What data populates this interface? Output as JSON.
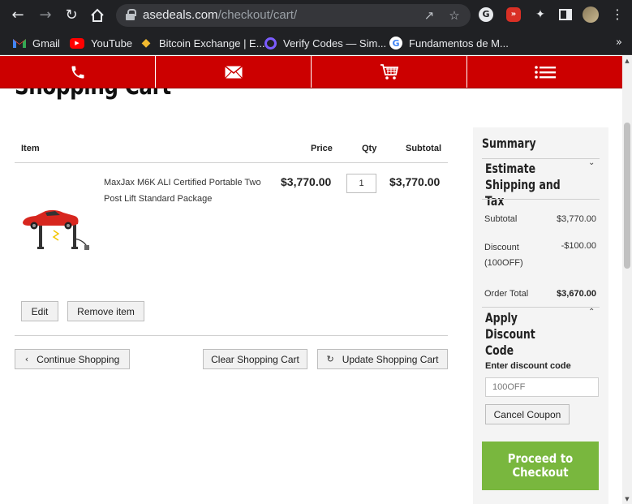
{
  "browser": {
    "url_host": "asedeals.com",
    "url_path": "/checkout/cart/",
    "bookmarks": [
      {
        "label": "Gmail",
        "icon": "gmail-icon"
      },
      {
        "label": "YouTube",
        "icon": "youtube-icon"
      },
      {
        "label": "Bitcoin Exchange | E...",
        "icon": "binance-icon"
      },
      {
        "label": "Verify Codes — Sim...",
        "icon": "verify-codes-icon"
      },
      {
        "label": "Fundamentos de M...",
        "icon": "google-icon"
      }
    ]
  },
  "topbar": {
    "background": "#cc0000",
    "items": [
      "phone-icon",
      "mail-icon",
      "cart-icon",
      "menu-icon"
    ]
  },
  "page": {
    "title": "Shopping Cart"
  },
  "cart": {
    "headers": {
      "item": "Item",
      "price": "Price",
      "qty": "Qty",
      "subtotal": "Subtotal"
    },
    "items": [
      {
        "name": "MaxJax M6K ALI Certified Portable Two Post Lift Standard Package",
        "price": "$3,770.00",
        "qty": "1",
        "subtotal": "$3,770.00"
      }
    ],
    "edit_label": "Edit",
    "remove_label": "Remove item",
    "continue_label": "Continue Shopping",
    "clear_label": "Clear Shopping Cart",
    "update_label": "Update Shopping Cart"
  },
  "summary": {
    "title": "Summary",
    "estimate_title": "Estimate Shipping and Tax",
    "subtotal_label": "Subtotal",
    "subtotal_value": "$3,770.00",
    "discount_label": "Discount (100OFF)",
    "discount_value": "-$100.00",
    "order_total_label": "Order Total",
    "order_total_value": "$3,670.00",
    "apply_discount_title": "Apply Discount Code",
    "enter_code_label": "Enter discount code",
    "code_placeholder": "100OFF",
    "cancel_coupon_label": "Cancel Coupon",
    "proceed_label": "Proceed to Checkout",
    "proceed_color": "#79b73e"
  }
}
